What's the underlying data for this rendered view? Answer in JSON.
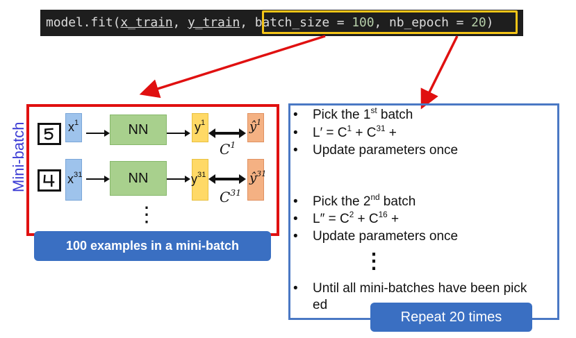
{
  "code": {
    "prefix": "model.fit(",
    "x_arg": "x_train",
    "sep1": ", ",
    "y_arg": "y_train",
    "sep2": ", ",
    "batch_key": "batch_size = ",
    "batch_val": "100",
    "sep3": ", ",
    "epoch_key": "nb_epoch = ",
    "epoch_val": "20",
    "suffix": ")"
  },
  "mini_batch": {
    "side_label": "Mini-batch",
    "row1": {
      "x": "x",
      "x_sup": "1",
      "nn": "NN",
      "y": "y",
      "y_sup": "1",
      "yhat": "ŷ",
      "yhat_sup": "1",
      "c": "C",
      "c_sup": "1"
    },
    "row2": {
      "x": "x",
      "x_sup": "31",
      "nn": "NN",
      "y": "y",
      "y_sup": "31",
      "yhat": "ŷ",
      "yhat_sup": "31",
      "c": "C",
      "c_sup": "31"
    },
    "ellipsis": "⋮",
    "banner": "100 examples in a mini-batch"
  },
  "procedure": {
    "bullet": "•",
    "b1_pre": "Pick the 1",
    "b1_sup": "st",
    "b1_post": " batch",
    "b2_a": "L",
    "b2_prime": "′",
    "b2_b": " = C",
    "b2_s1": "1",
    "b2_c": " + C",
    "b2_s2": "31",
    "b2_d": " + ",
    "b3": "Update parameters once",
    "b4_pre": "Pick the 2",
    "b4_sup": "nd",
    "b4_post": " batch",
    "b5_a": "L",
    "b5_prime": "″",
    "b5_b": " = C",
    "b5_s1": "2",
    "b5_c": " + C",
    "b5_s2": "16",
    "b5_d": " + ",
    "b6": "Update parameters once",
    "ellipsis": "⋮",
    "b7_line1": "Until all mini-batches have been pick",
    "b7_line2": "ed",
    "banner": "Repeat 20 times"
  },
  "colors": {
    "red": "#e01010",
    "blue": "#4a78c4",
    "banner": "#3a6fc2",
    "highlight": "#f5c518"
  }
}
